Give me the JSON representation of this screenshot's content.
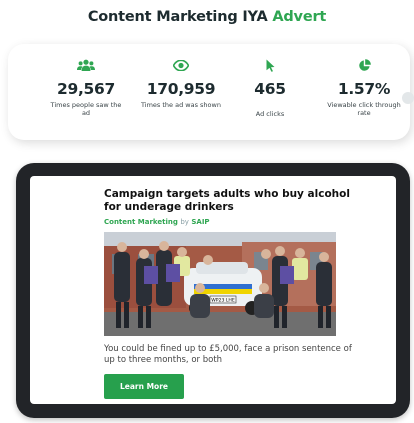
{
  "header": {
    "title_main": "Content Marketing IYA",
    "title_accent": "Advert"
  },
  "colors": {
    "accent": "#2fa652",
    "button": "#27a04d",
    "tablet_frame": "#222428"
  },
  "stats": [
    {
      "icon": "users-icon",
      "value": "29,567",
      "label": "Times people saw the ad"
    },
    {
      "icon": "eye-icon",
      "value": "170,959",
      "label": "Times the ad was shown"
    },
    {
      "icon": "cursor-icon",
      "value": "465",
      "label": "Ad clicks"
    },
    {
      "icon": "pie-chart-icon",
      "value": "1.57%",
      "label": "Viewable click through rate"
    }
  ],
  "ad": {
    "headline": "Campaign targets adults who buy alcohol for underage drinkers",
    "category": "Content Marketing",
    "by": "by",
    "publisher": "SAIP",
    "body": "You could be fined up to £5,000, face a prison sentence of up to three months, or both",
    "cta_label": "Learn More",
    "photo_description": "group of officers and officials holding posters in front of a police car",
    "plate_text": "WP23 LHE"
  }
}
